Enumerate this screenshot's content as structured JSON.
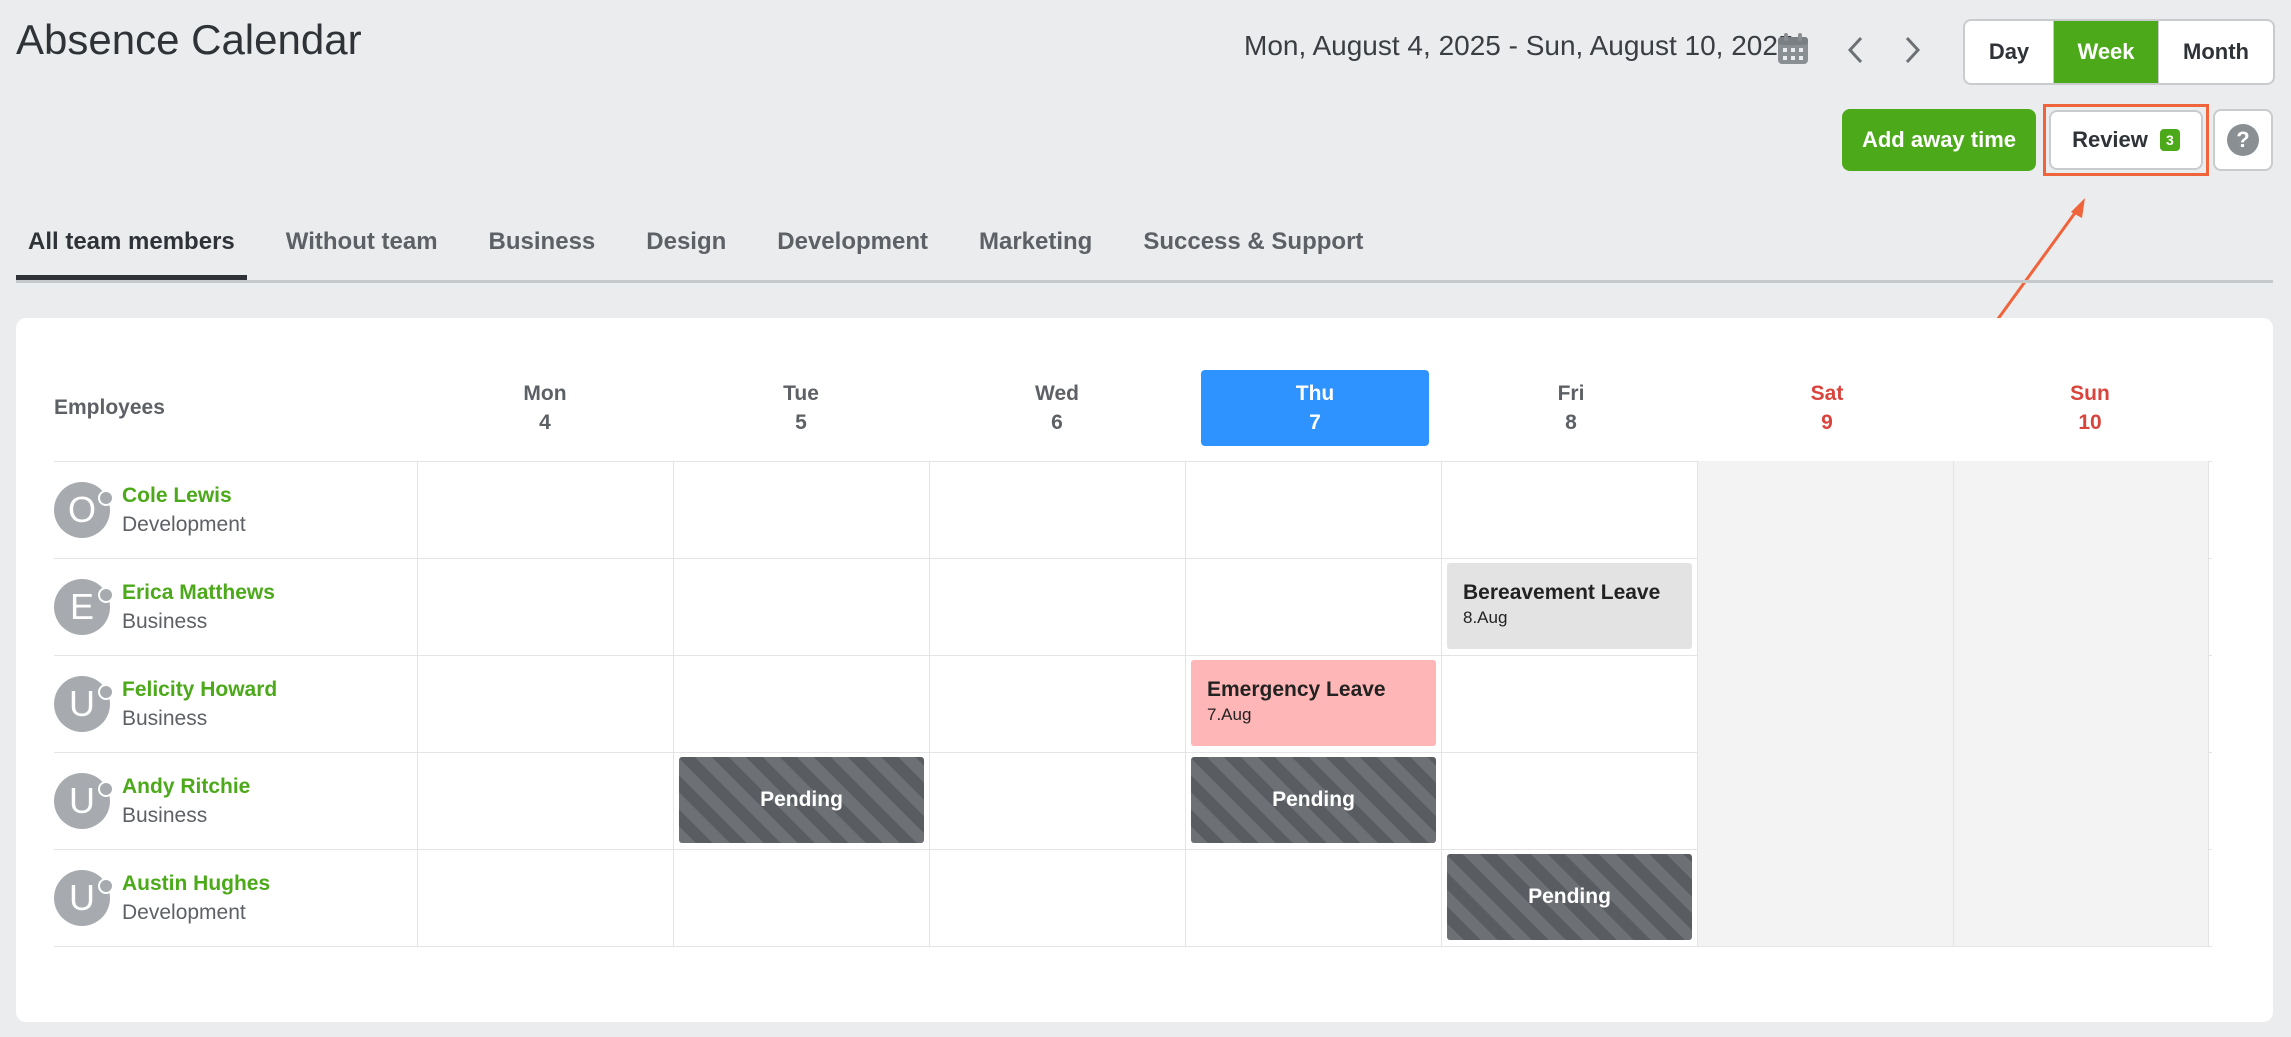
{
  "header": {
    "title": "Absence Calendar",
    "date_range": "Mon, August 4, 2025 - Sun, August 10, 2025",
    "view_options": [
      "Day",
      "Week",
      "Month"
    ],
    "selected_view": "Week",
    "add_button": "Add away time",
    "review_button": "Review",
    "review_count": "3",
    "help_button": "?"
  },
  "tabs": [
    "All team members",
    "Without team",
    "Business",
    "Design",
    "Development",
    "Marketing",
    "Success & Support"
  ],
  "active_tab": "All team members",
  "grid": {
    "employees_label": "Employees",
    "days": [
      {
        "name": "Mon",
        "num": "4"
      },
      {
        "name": "Tue",
        "num": "5"
      },
      {
        "name": "Wed",
        "num": "6"
      },
      {
        "name": "Thu",
        "num": "7"
      },
      {
        "name": "Fri",
        "num": "8"
      },
      {
        "name": "Sat",
        "num": "9"
      },
      {
        "name": "Sun",
        "num": "10"
      }
    ],
    "employees": [
      {
        "initial": "O",
        "name": "Cole Lewis",
        "team": "Development"
      },
      {
        "initial": "E",
        "name": "Erica Matthews",
        "team": "Business"
      },
      {
        "initial": "U",
        "name": "Felicity Howard",
        "team": "Business"
      },
      {
        "initial": "U",
        "name": "Andy Ritchie",
        "team": "Business"
      },
      {
        "initial": "U",
        "name": "Austin Hughes",
        "team": "Development"
      }
    ],
    "events": {
      "bereavement": {
        "title": "Bereavement Leave",
        "date": "8.Aug"
      },
      "emergency": {
        "title": "Emergency Leave",
        "date": "7.Aug"
      },
      "pending_label": "Pending"
    }
  },
  "colors": {
    "accent_green": "#4caa1a",
    "today_blue": "#2e92ff",
    "weekend_red": "#d9443c",
    "highlight_orange": "#f0643c",
    "emergency_pink": "#ffb6b6"
  }
}
